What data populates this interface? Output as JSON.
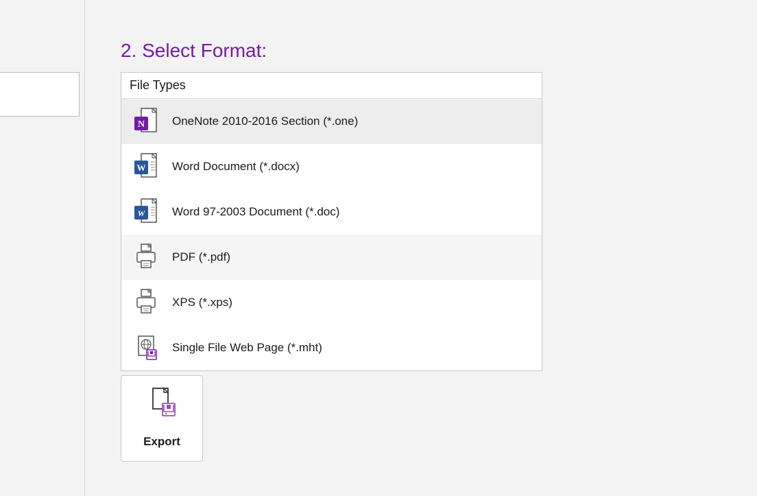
{
  "heading": "2. Select Format:",
  "panel_header": "File Types",
  "file_types": [
    {
      "label": "OneNote 2010-2016 Section (*.one)"
    },
    {
      "label": "Word Document (*.docx)"
    },
    {
      "label": "Word 97-2003 Document (*.doc)"
    },
    {
      "label": "PDF (*.pdf)"
    },
    {
      "label": "XPS (*.xps)"
    },
    {
      "label": "Single File Web Page (*.mht)"
    }
  ],
  "export_button": "Export"
}
